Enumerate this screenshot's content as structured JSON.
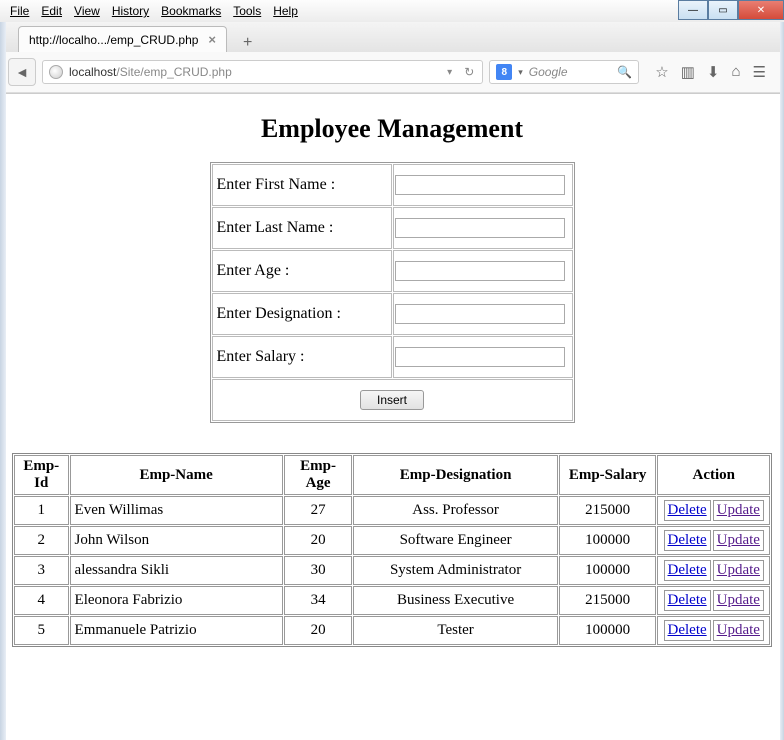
{
  "menubar": [
    "File",
    "Edit",
    "View",
    "History",
    "Bookmarks",
    "Tools",
    "Help"
  ],
  "tab": {
    "title": "http://localho.../emp_CRUD.php"
  },
  "url": {
    "host": "localhost",
    "path": "/Site/emp_CRUD.php"
  },
  "search": {
    "engine_label": "8",
    "placeholder": "Google"
  },
  "page": {
    "title": "Employee Management",
    "form_labels": {
      "first_name": "Enter First Name :",
      "last_name": "Enter Last Name :",
      "age": "Enter Age :",
      "designation": "Enter Designation :",
      "salary": "Enter Salary :"
    },
    "insert_label": "Insert",
    "table": {
      "headers": [
        "Emp-Id",
        "Emp-Name",
        "Emp-Age",
        "Emp-Designation",
        "Emp-Salary",
        "Action"
      ],
      "action_labels": {
        "delete": "Delete",
        "update": "Update"
      },
      "rows": [
        {
          "id": "1",
          "name": "Even Willimas",
          "age": "27",
          "designation": "Ass. Professor",
          "salary": "215000"
        },
        {
          "id": "2",
          "name": "John Wilson",
          "age": "20",
          "designation": "Software Engineer",
          "salary": "100000"
        },
        {
          "id": "3",
          "name": "alessandra Sikli",
          "age": "30",
          "designation": "System Administrator",
          "salary": "100000"
        },
        {
          "id": "4",
          "name": "Eleonora Fabrizio",
          "age": "34",
          "designation": "Business Executive",
          "salary": "215000"
        },
        {
          "id": "5",
          "name": "Emmanuele Patrizio",
          "age": "20",
          "designation": "Tester",
          "salary": "100000"
        }
      ]
    }
  }
}
